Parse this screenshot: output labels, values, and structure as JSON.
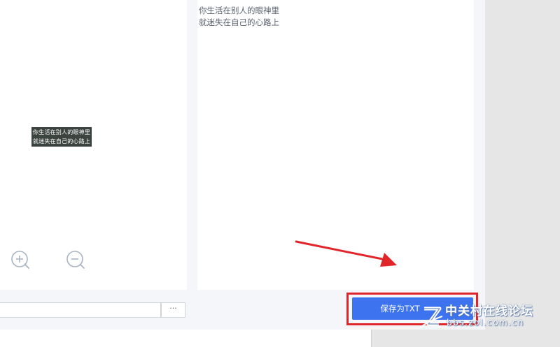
{
  "image_preview": {
    "lines": [
      "你生活在别人的眼神里",
      "就迷失在自己的心路上"
    ]
  },
  "zoom": {
    "in_icon": "zoom-in-icon",
    "out_icon": "zoom-out-icon"
  },
  "result": {
    "lines": [
      "你生活在别人的眼神里",
      "就迷失在自己的心路上"
    ]
  },
  "output": {
    "path_value": "",
    "browse_label": "···"
  },
  "save_button": {
    "label": "保存为TXT"
  },
  "watermark": {
    "title": "中关村在线论坛",
    "url": "bbs.zol.com.cn"
  },
  "colors": {
    "accent": "#3d73ee",
    "highlight": "#e0262b",
    "panel_bg": "#ffffff",
    "dialog_bg": "#f4f6f9"
  }
}
